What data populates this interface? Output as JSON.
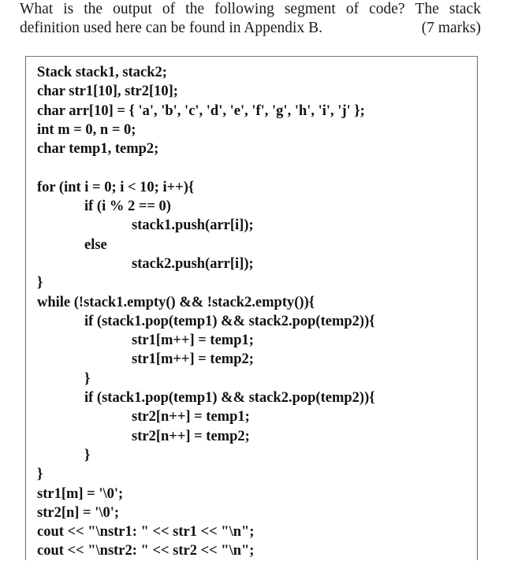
{
  "question": {
    "line1_words": [
      "What",
      "is",
      "the",
      "output",
      "of",
      "the",
      "following",
      "segment",
      "of",
      "code?",
      "The",
      "stack"
    ],
    "line2_text": "definition used here can be found in Appendix B.",
    "marks": "(7 marks)"
  },
  "code": {
    "lines": [
      {
        "indent": 0,
        "text": "Stack stack1, stack2;"
      },
      {
        "indent": 0,
        "text": "char str1[10], str2[10];"
      },
      {
        "indent": 0,
        "text": "char arr[10] = { 'a', 'b', 'c', 'd', 'e', 'f', 'g', 'h', 'i', 'j' };"
      },
      {
        "indent": 0,
        "text": "int m = 0, n = 0;"
      },
      {
        "indent": 0,
        "text": "char temp1, temp2;"
      },
      {
        "indent": 0,
        "text": ""
      },
      {
        "indent": 0,
        "text": "for (int i = 0; i < 10; i++){"
      },
      {
        "indent": 1,
        "text": "if (i % 2 == 0)"
      },
      {
        "indent": 2,
        "text": "stack1.push(arr[i]);"
      },
      {
        "indent": 1,
        "text": "else"
      },
      {
        "indent": 2,
        "text": "stack2.push(arr[i]);"
      },
      {
        "indent": 0,
        "text": "}"
      },
      {
        "indent": 0,
        "text": "while (!stack1.empty() && !stack2.empty()){"
      },
      {
        "indent": 1,
        "text": "if (stack1.pop(temp1) && stack2.pop(temp2)){"
      },
      {
        "indent": 2,
        "text": "str1[m++] = temp1;"
      },
      {
        "indent": 2,
        "text": "str1[m++] = temp2;"
      },
      {
        "indent": 1,
        "text": "}"
      },
      {
        "indent": 1,
        "text": "if (stack1.pop(temp1) && stack2.pop(temp2)){"
      },
      {
        "indent": 2,
        "text": "str2[n++] = temp1;"
      },
      {
        "indent": 2,
        "text": "str2[n++] = temp2;"
      },
      {
        "indent": 1,
        "text": "}"
      },
      {
        "indent": 0,
        "text": "}"
      },
      {
        "indent": 0,
        "text": "str1[m] = '\\0';"
      },
      {
        "indent": 0,
        "text": "str2[n] = '\\0';"
      },
      {
        "indent": 0,
        "text": "cout << \"\\nstr1: \" << str1 << \"\\n\";"
      },
      {
        "indent": 0,
        "text": "cout << \"\\nstr2: \" << str2 << \"\\n\";"
      }
    ]
  }
}
